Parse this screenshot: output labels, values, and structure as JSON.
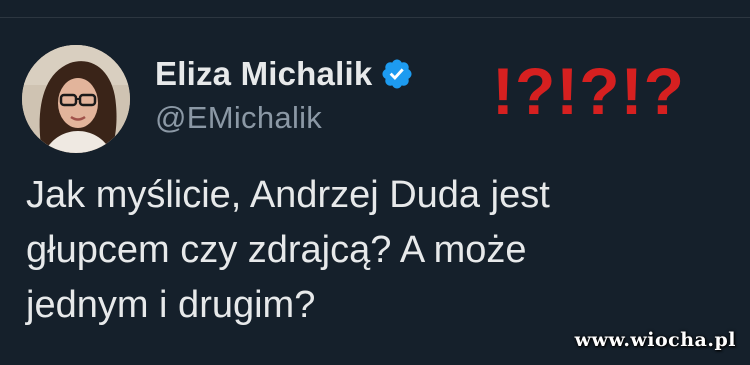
{
  "user": {
    "display_name": "Eliza Michalik",
    "handle": "@EMichalik",
    "verified_icon": "verified-badge-icon"
  },
  "overlay_mark": "!?!?!?",
  "tweet": {
    "lines": [
      "Jak myślicie, Andrzej Duda jest",
      "głupcem czy zdrajcą? A może",
      "jednym i drugim?"
    ]
  },
  "watermark": "www.wiocha.pl",
  "colors": {
    "background": "#15202b",
    "name": "#e7e9ea",
    "handle": "#8b98a5",
    "verified": "#1d9bf0",
    "overlay": "#d62020"
  }
}
